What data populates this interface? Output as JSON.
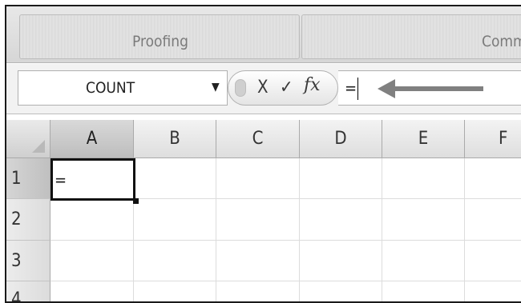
{
  "ribbon": {
    "groups": [
      {
        "label": "Proofing"
      },
      {
        "label": "Comm"
      }
    ]
  },
  "formula_bar": {
    "name_box_value": "COUNT",
    "cancel_glyph": "X",
    "enter_glyph": "✓",
    "fx_glyph": "fx",
    "formula_text": "="
  },
  "grid": {
    "columns": [
      "A",
      "B",
      "C",
      "D",
      "E",
      "F"
    ],
    "rows": [
      "1",
      "2",
      "3",
      "4"
    ],
    "cell_a1": "="
  },
  "icons": {
    "dropdown": "chevron-down-icon",
    "cancel": "cancel-icon",
    "enter": "checkmark-icon",
    "function": "function-icon",
    "pointer": "left-arrow-icon",
    "select_all": "select-all-icon"
  },
  "colors": {
    "ribbon": "#d8d8d8",
    "header": "#e3e3e3",
    "active_header": "#c4c4c4",
    "arrow": "#808080"
  }
}
